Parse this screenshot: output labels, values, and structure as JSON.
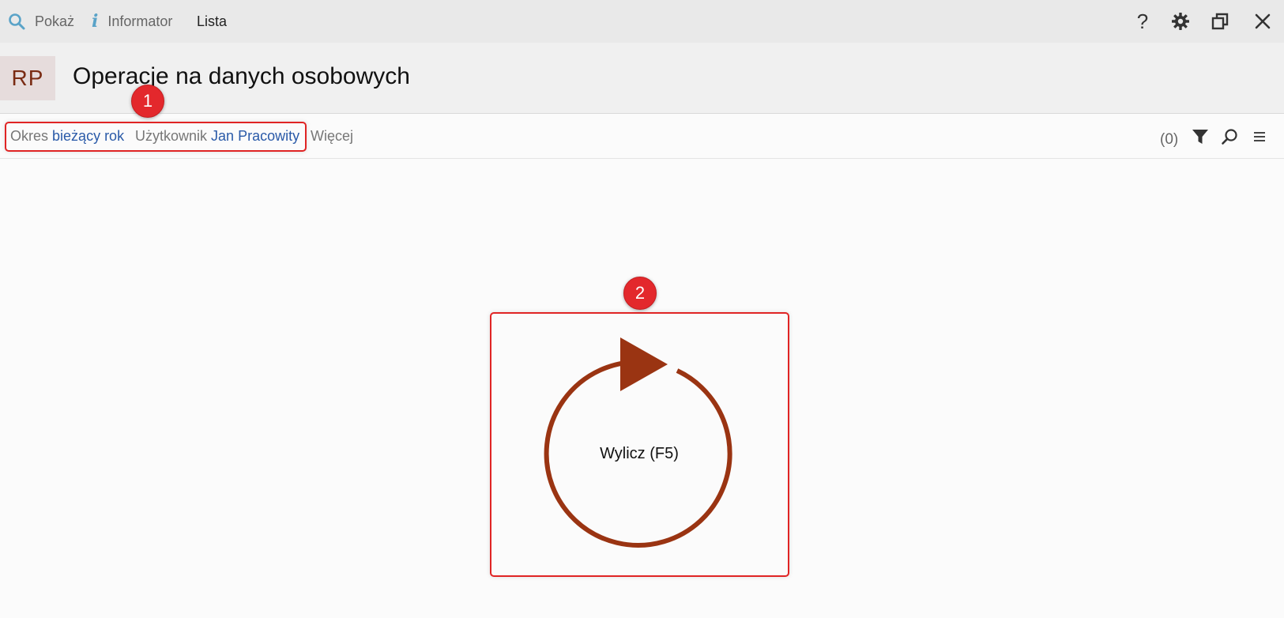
{
  "topbar": {
    "show_label": "Pokaż",
    "informator_label": "Informator",
    "list_label": "Lista",
    "icons": [
      "search-icon",
      "info-icon",
      "help-icon",
      "gear-icon",
      "restore-window-icon",
      "close-icon"
    ]
  },
  "header": {
    "avatar_text": "RP",
    "title": "Operacje na danych osobowych"
  },
  "filters": {
    "period_label": "Okres",
    "period_value": "bieżący rok",
    "user_label": "Użytkownik",
    "user_value": "Jan Pracowity",
    "more_label": "Więcej",
    "count": "(0)",
    "icons": [
      "filter-icon",
      "search-icon",
      "menu-icon"
    ]
  },
  "markers": {
    "one": "1",
    "two": "2"
  },
  "main": {
    "calculate_label": "Wylicz (F5)"
  },
  "colors": {
    "accent": "#9a3412",
    "link": "#2a5aa8",
    "highlight": "#e02424"
  }
}
